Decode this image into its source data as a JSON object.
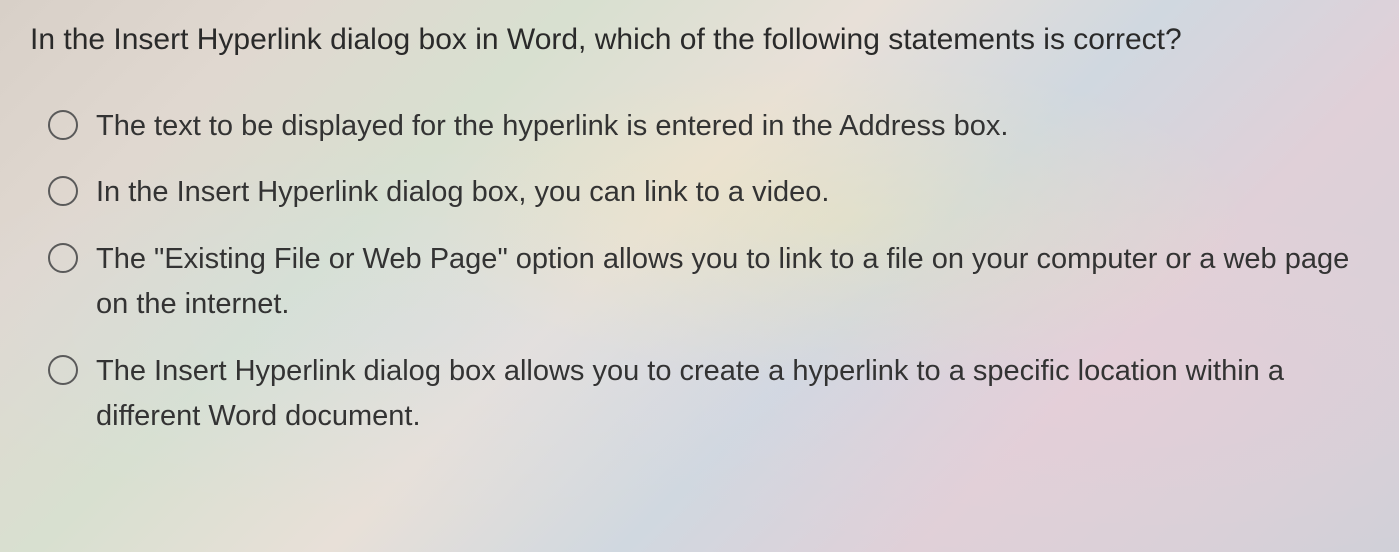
{
  "question": {
    "stem": "In the Insert Hyperlink dialog box in Word, which of the following statements is correct?",
    "options": [
      "The text to be displayed for the hyperlink is entered in the Address box.",
      "In the Insert Hyperlink dialog box, you can link to a video.",
      "The \"Existing File or Web Page\" option allows you to link to a file on your computer or a web page on the internet.",
      "The Insert Hyperlink dialog box allows you to create a hyperlink to a specific location within a different Word document."
    ]
  }
}
